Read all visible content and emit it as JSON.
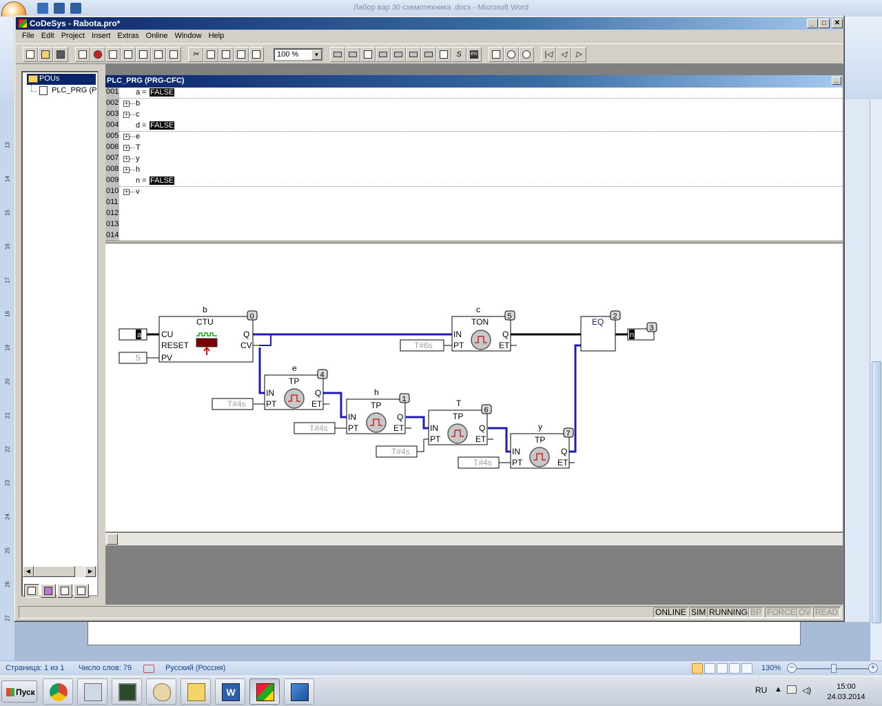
{
  "word": {
    "title": "Лабор вар 30 схемотехника .docx - Microsoft Word",
    "status": {
      "page": "Страница: 1 из 1",
      "words": "Число слов: 79",
      "language": "Русский (Россия)",
      "zoom": "130%"
    },
    "ruler_numbers": [
      "13",
      "14",
      "15",
      "16",
      "17",
      "18",
      "19",
      "20",
      "21",
      "22",
      "23",
      "24",
      "25",
      "26",
      "27"
    ]
  },
  "taskbar": {
    "start_label": "Пуск",
    "language": "RU",
    "time": "15:00",
    "date": "24.03.2014"
  },
  "codesys": {
    "title": "CoDeSys - Rabota.pro*",
    "menu": [
      "File",
      "Edit",
      "Project",
      "Insert",
      "Extras",
      "Online",
      "Window",
      "Help"
    ],
    "zoom_value": "100 %",
    "pous": {
      "root": "POUs",
      "item": "PLC_PRG (P"
    },
    "editor_title": "PLC_PRG (PRG-CFC)",
    "declarations": [
      {
        "num": "001",
        "name": "a",
        "value": "FALSE",
        "expandable": false
      },
      {
        "num": "002",
        "name": "b",
        "value": "",
        "expandable": true
      },
      {
        "num": "003",
        "name": "c",
        "value": "",
        "expandable": true
      },
      {
        "num": "004",
        "name": "d",
        "value": "FALSE",
        "expandable": false
      },
      {
        "num": "005",
        "name": "e",
        "value": "",
        "expandable": true
      },
      {
        "num": "006",
        "name": "T",
        "value": "",
        "expandable": true
      },
      {
        "num": "007",
        "name": "y",
        "value": "",
        "expandable": true
      },
      {
        "num": "008",
        "name": "h",
        "value": "",
        "expandable": true
      },
      {
        "num": "009",
        "name": "n",
        "value": "FALSE",
        "expandable": false
      },
      {
        "num": "010",
        "name": "v",
        "value": "",
        "expandable": true
      },
      {
        "num": "011",
        "name": "",
        "value": "",
        "expandable": false
      },
      {
        "num": "012",
        "name": "",
        "value": "",
        "expandable": false
      },
      {
        "num": "013",
        "name": "",
        "value": "",
        "expandable": false
      },
      {
        "num": "014",
        "name": "",
        "value": "",
        "expandable": false
      }
    ],
    "cfc": {
      "input_a": "a",
      "input_pv": "5",
      "output_n": "n",
      "blocks": {
        "ctu": {
          "instance": "b",
          "type": "CTU",
          "order": "0",
          "in": [
            "CU",
            "RESET",
            "PV"
          ],
          "out": [
            "Q",
            "CV"
          ]
        },
        "ton": {
          "instance": "c",
          "type": "TON",
          "order": "5",
          "in": [
            "IN",
            "PT"
          ],
          "out": [
            "Q",
            "ET"
          ],
          "pt": "T#6s"
        },
        "eq": {
          "type": "EQ",
          "order": "2"
        },
        "out_order": "3",
        "tp_e": {
          "instance": "e",
          "type": "TP",
          "order": "4",
          "pt": "T#4s"
        },
        "tp_h": {
          "instance": "h",
          "type": "TP",
          "order": "1",
          "pt": "T#4s"
        },
        "tp_T": {
          "instance": "T",
          "type": "TP",
          "order": "6",
          "pt": "T#4s"
        },
        "tp_y": {
          "instance": "y",
          "type": "TP",
          "order": "7",
          "pt": "T#4s"
        }
      },
      "pin_labels": {
        "in": "IN",
        "pt": "PT",
        "q": "Q",
        "et": "ET"
      }
    },
    "status": {
      "online": "ONLINE",
      "sim": "SIM",
      "running": "RUNNING",
      "bp": "BP",
      "force": "FORCE",
      "ov": "OV",
      "read": "READ"
    }
  },
  "colors": {
    "wire_active": "#1c1cb4",
    "wire_inactive": "#000000",
    "window_title": "#0a246a",
    "const_text": "#a0a0a0"
  }
}
